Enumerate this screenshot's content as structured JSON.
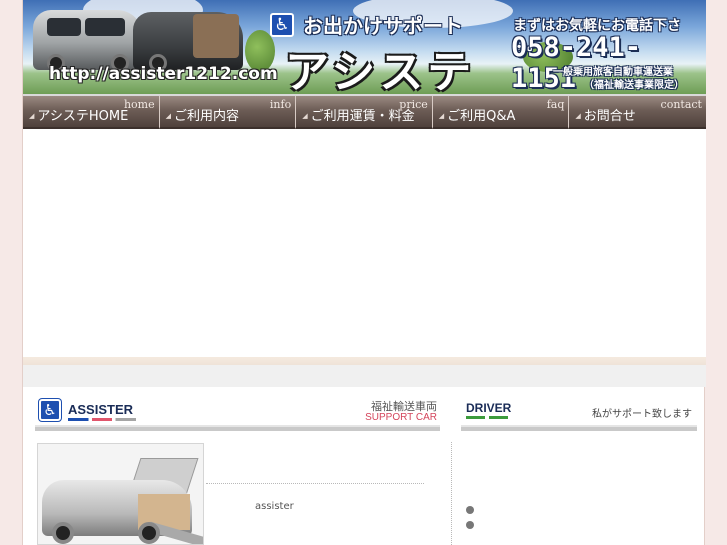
{
  "header": {
    "url": "http://assister1212.com",
    "tagline": "お出かけサポート",
    "brand": "アシステ",
    "call_prompt": "まずはお気軽にお電話下さい。",
    "phone": "058-241-1151",
    "license_line1": "一般乗用旅客自動車運送業",
    "license_line2": "（福祉輸送事業限定）",
    "icon": "wheelchair-icon"
  },
  "nav": {
    "items": [
      {
        "en": "home",
        "jp": "アシステHOME"
      },
      {
        "en": "info",
        "jp": "ご利用内容"
      },
      {
        "en": "price",
        "jp": "ご利用運賃・料金"
      },
      {
        "en": "faq",
        "jp": "ご利用Q&A"
      },
      {
        "en": "contact",
        "jp": "お問合せ"
      }
    ]
  },
  "assister_section": {
    "title": "ASSISTER",
    "subtitle_jp": "福祉輸送車両",
    "subtitle_en": "SUPPORT CAR",
    "caption": "assister"
  },
  "driver_section": {
    "title": "DRIVER",
    "subtitle": "私がサポート致します"
  }
}
